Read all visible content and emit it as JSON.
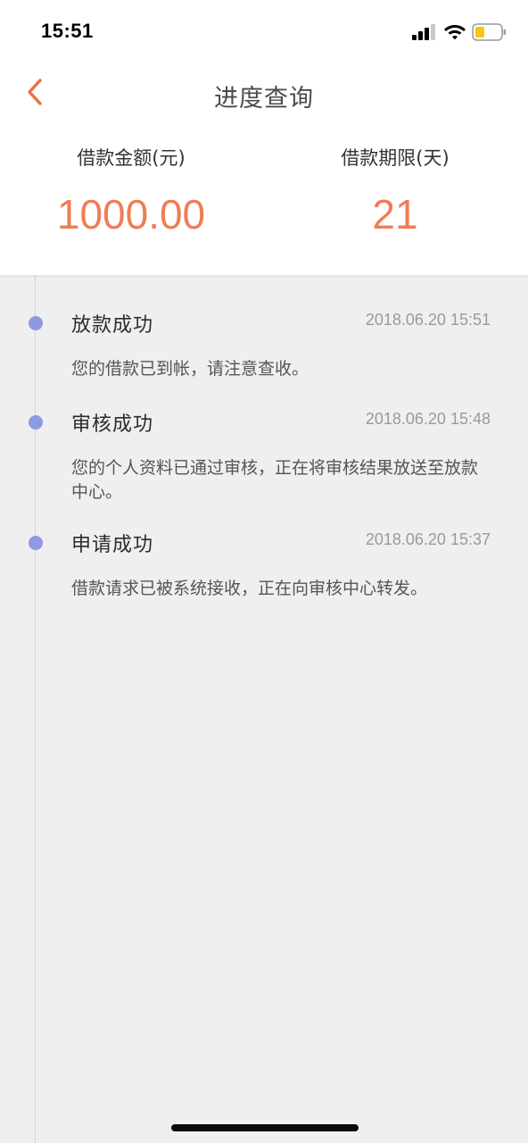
{
  "status_bar": {
    "time": "15:51"
  },
  "nav": {
    "title": "进度查询",
    "back_icon": "chevron-left-icon",
    "accent_color": "#ef6f45"
  },
  "summary": {
    "amount_label": "借款金额(元)",
    "amount_value": "1000.00",
    "term_label": "借款期限(天)",
    "term_value": "21",
    "value_color": "#ef7d56"
  },
  "timeline": {
    "dot_color": "#8d99e0",
    "events": [
      {
        "title": "放款成功",
        "time": "2018.06.20 15:51",
        "desc": "您的借款已到帐，请注意查收。"
      },
      {
        "title": "审核成功",
        "time": "2018.06.20 15:48",
        "desc": "您的个人资料已通过审核，正在将审核结果放送至放款中心。"
      },
      {
        "title": "申请成功",
        "time": "2018.06.20 15:37",
        "desc": "借款请求已被系统接收，正在向审核中心转发。"
      }
    ]
  }
}
